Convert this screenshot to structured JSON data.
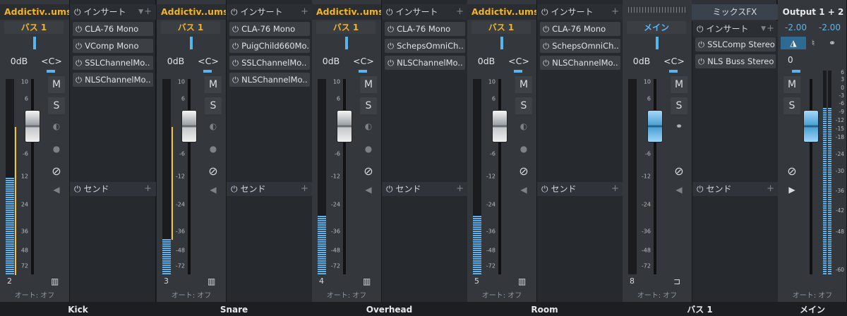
{
  "channels": [
    {
      "source": "Addictiv..ums2",
      "bus": "バス 1",
      "vol": "0dB",
      "pan": "<C>",
      "number": "2",
      "auto": "オート: オフ",
      "name": "Kick",
      "insert_label": "インサート",
      "plugins": [
        "CLA-76 Mono",
        "VComp Mono",
        "SSLChannelMo..",
        "NLSChannelMo.."
      ],
      "send_label": "センド",
      "meter_level": 0.5
    },
    {
      "source": "Addictiv..ums2",
      "bus": "バス 1",
      "vol": "0dB",
      "pan": "<C>",
      "number": "3",
      "auto": "オート: オフ",
      "name": "Snare",
      "insert_label": "インサート",
      "plugins": [
        "CLA-76 Mono",
        "PuigChild660Mo..",
        "SSLChannelMo..",
        "NLSChannelMo.."
      ],
      "send_label": "センド",
      "meter_level": 0.18
    },
    {
      "source": "Addictiv..ums2",
      "bus": "バス 1",
      "vol": "0dB",
      "pan": "<C>",
      "number": "4",
      "auto": "オート: オフ",
      "name": "Overhead",
      "insert_label": "インサート",
      "plugins": [
        "CLA-76 Mono",
        "SchepsOmniCh..",
        "NLSChannelMo.."
      ],
      "send_label": "センド",
      "meter_level": 0.3
    },
    {
      "source": "Addictiv..ums2",
      "bus": "バス 1",
      "vol": "0dB",
      "pan": "<C>",
      "number": "5",
      "auto": "オート: オフ",
      "name": "Room",
      "insert_label": "インサート",
      "plugins": [
        "CLA-76 Mono",
        "SchepsOmniCh..",
        "NLSChannelMo.."
      ],
      "send_label": "センド",
      "meter_level": 0.3
    }
  ],
  "bus1": {
    "bus": "メイン",
    "vol": "0dB",
    "pan": "<C>",
    "number": "8",
    "auto": "オート: オフ",
    "name": "バス 1",
    "fx_label": "ミックスFX",
    "insert_label": "インサート",
    "plugins": [
      "SSLComp Stereo",
      "NLS Buss Stereo"
    ],
    "send_label": "センド"
  },
  "main": {
    "output": "Output 1 + 2",
    "left": "-2.00",
    "right": "-2.00",
    "vol": "0",
    "auto": "オート: オフ",
    "name": "メイン",
    "scale": [
      "6",
      "3",
      "0",
      "-3",
      "-6",
      "-9",
      "-12",
      "-15",
      "-18",
      "-24",
      "-30",
      "-36",
      "-42",
      "-48",
      "-60"
    ]
  },
  "scale": [
    "10",
    "6",
    "0",
    "-6",
    "12",
    "24",
    "36",
    "48",
    "72"
  ],
  "scale_neg": [
    "10",
    "6",
    "0",
    "-6",
    "-12",
    "-24",
    "-36",
    "-48",
    "-72"
  ],
  "mute_label": "M",
  "solo_label": "S"
}
